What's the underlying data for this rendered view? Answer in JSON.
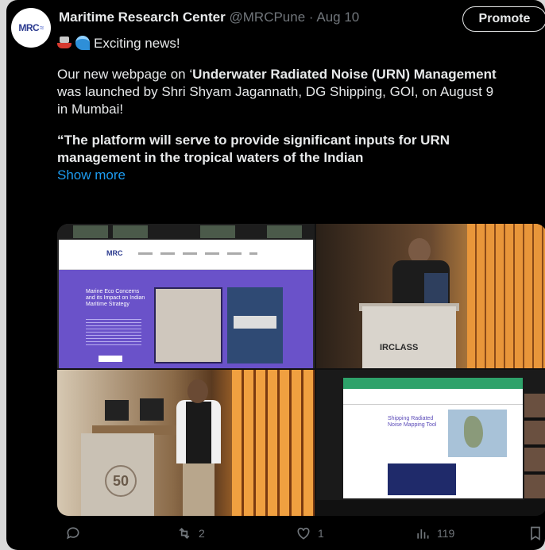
{
  "tweet": {
    "author_name": "Maritime Research Center",
    "author_handle": "@MRCPune",
    "separator": " · ",
    "date": "Aug 10",
    "avatar_text": "MRC",
    "promote_label": "Promote",
    "lines": {
      "headline": "Exciting news!",
      "l1_prefix": "Our new webpage on ‘",
      "l1_bold": "Underwater Radiated Noise (URN) Management",
      "l2": "was launched by Shri Shyam Jagannath, DG Shipping, GOI, on August 9",
      "l3": "in Mumbai!",
      "q1": "“The platform will serve to provide significant inputs for URN",
      "q2": "management in the tropical waters of the Indian",
      "show_more": "Show more"
    },
    "media": {
      "t1_title": "Marine Eco Concerns and its Impact on Indian Maritime Strategy",
      "t1_logo": "MRC",
      "t2_sign": "IRCLASS",
      "t3_badge": "50",
      "t4_title": "Shipping Radiated Noise Mapping Tool"
    },
    "actions": {
      "replies": "",
      "retweets": "2",
      "likes": "1",
      "views": "119"
    }
  },
  "colors": {
    "background": "#000000",
    "text": "#e7e9ea",
    "muted": "#71767b",
    "link": "#1d9bf0"
  }
}
